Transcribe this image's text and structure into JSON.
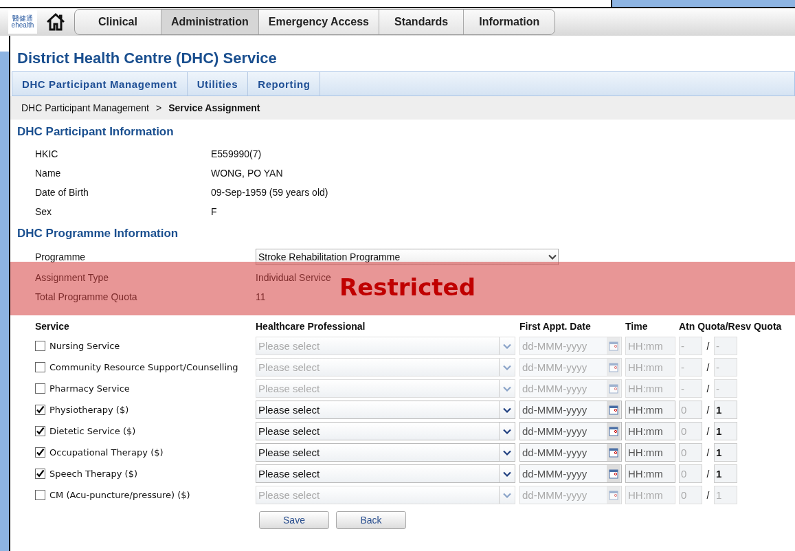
{
  "logo": {
    "name_zh": "醫健通",
    "name_en": "ehealth"
  },
  "nav_tabs": [
    {
      "label": "Clinical",
      "selected": false
    },
    {
      "label": "Administration",
      "selected": true
    },
    {
      "label": "Emergency Access",
      "selected": false
    },
    {
      "label": "Standards",
      "selected": false
    },
    {
      "label": "Information",
      "selected": false
    }
  ],
  "page_title": "District Health Centre (DHC) Service",
  "sub_nav": [
    {
      "label": "DHC Participant Management"
    },
    {
      "label": "Utilities"
    },
    {
      "label": "Reporting"
    }
  ],
  "breadcrumb": {
    "parent": "DHC Participant Management",
    "separator": ">",
    "current": "Service Assignment"
  },
  "participant_info": {
    "title": "DHC Participant Information",
    "fields": [
      {
        "label": "HKIC",
        "value": "E559990(7)"
      },
      {
        "label": "Name",
        "value": "WONG, PO YAN"
      },
      {
        "label": "Date of Birth",
        "value": "09-Sep-1959 (59 years old)"
      },
      {
        "label": "Sex",
        "value": "F"
      }
    ]
  },
  "programme_info": {
    "title": "DHC Programme Information",
    "programme": {
      "label": "Programme",
      "value": "Stroke Rehabilitation Programme"
    },
    "fields": [
      {
        "label": "Assignment Type",
        "value": "Individual Service"
      },
      {
        "label": "Total Programme Quota",
        "value": "11"
      }
    ]
  },
  "services": {
    "columns": [
      "Service",
      "Healthcare Professional",
      "First Appt. Date",
      "Time",
      "Atn Quota/Resv Quota"
    ],
    "rows": [
      {
        "name": "Nursing Service",
        "checked": false,
        "disabled": true,
        "professional": "Please select",
        "date_placeholder": "dd-MMM-yyyy",
        "time_placeholder": "HH:mm",
        "atn_quota": "-",
        "separator": "/",
        "resv_quota": "-"
      },
      {
        "name": "Community Resource Support/Counselling",
        "checked": false,
        "disabled": true,
        "professional": "Please select",
        "date_placeholder": "dd-MMM-yyyy",
        "time_placeholder": "HH:mm",
        "atn_quota": "-",
        "separator": "/",
        "resv_quota": "-"
      },
      {
        "name": "Pharmacy Service",
        "checked": false,
        "disabled": true,
        "professional": "Please select",
        "date_placeholder": "dd-MMM-yyyy",
        "time_placeholder": "HH:mm",
        "atn_quota": "-",
        "separator": "/",
        "resv_quota": "-"
      },
      {
        "name": "Physiotherapy ($)",
        "checked": true,
        "disabled": false,
        "professional": "Please select",
        "date_placeholder": "dd-MMM-yyyy",
        "time_placeholder": "HH:mm",
        "atn_quota": "0",
        "separator": "/",
        "resv_quota": "1"
      },
      {
        "name": "Dietetic Service ($)",
        "checked": true,
        "disabled": false,
        "professional": "Please select",
        "date_placeholder": "dd-MMM-yyyy",
        "time_placeholder": "HH:mm",
        "atn_quota": "0",
        "separator": "/",
        "resv_quota": "1"
      },
      {
        "name": "Occupational Therapy ($)",
        "checked": true,
        "disabled": false,
        "professional": "Please select",
        "date_placeholder": "dd-MMM-yyyy",
        "time_placeholder": "HH:mm",
        "atn_quota": "0",
        "separator": "/",
        "resv_quota": "1"
      },
      {
        "name": "Speech Therapy ($)",
        "checked": true,
        "disabled": false,
        "professional": "Please select",
        "date_placeholder": "dd-MMM-yyyy",
        "time_placeholder": "HH:mm",
        "atn_quota": "0",
        "separator": "/",
        "resv_quota": "1"
      },
      {
        "name": "CM (Acu-puncture/pressure) ($)",
        "checked": false,
        "disabled": true,
        "professional": "Please select",
        "date_placeholder": "dd-MMM-yyyy",
        "time_placeholder": "HH:mm",
        "atn_quota": "0",
        "separator": "/",
        "resv_quota": "1"
      }
    ]
  },
  "buttons": [
    {
      "label": "Save"
    },
    {
      "label": "Back"
    }
  ],
  "overlay": {
    "text": "Restricted"
  }
}
